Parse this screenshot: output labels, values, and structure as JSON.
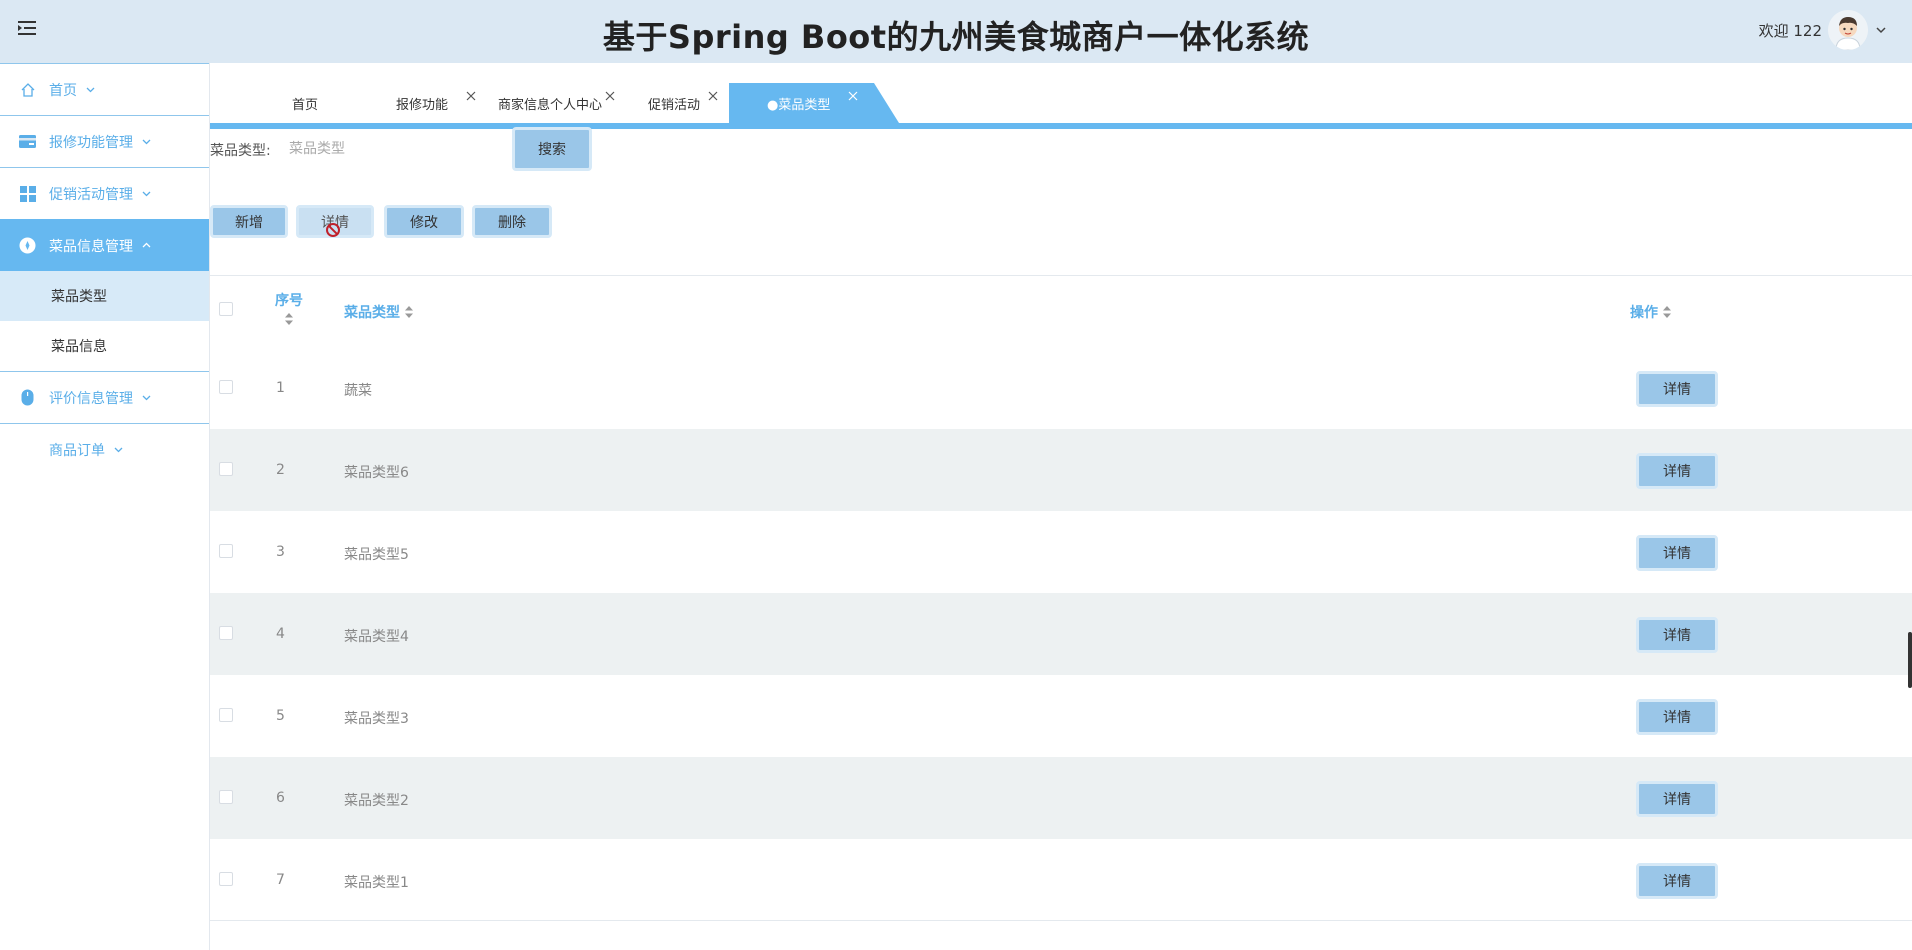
{
  "header": {
    "title": "基于Spring Boot的九州美食城商户一体化系统",
    "welcome": "欢迎 122"
  },
  "sidebar": {
    "items": [
      {
        "label": "首页",
        "icon": "home-icon"
      },
      {
        "label": "报修功能管理",
        "icon": "card-icon"
      },
      {
        "label": "促销活动管理",
        "icon": "grid-icon"
      },
      {
        "label": "菜品信息管理",
        "icon": "compass-icon",
        "active": true
      },
      {
        "label": "评价信息管理",
        "icon": "mouse-icon"
      },
      {
        "label": "商品订单"
      }
    ],
    "subitems": [
      {
        "label": "菜品类型",
        "active": true
      },
      {
        "label": "菜品信息"
      }
    ]
  },
  "tabs": [
    {
      "label": "首页"
    },
    {
      "label": "报修功能"
    },
    {
      "label": "商家信息个人中心"
    },
    {
      "label": "促销活动"
    },
    {
      "label": "●菜品类型",
      "active": true
    }
  ],
  "search": {
    "label": "菜品类型:",
    "placeholder": "菜品类型",
    "button": "搜索"
  },
  "actions": {
    "add": "新增",
    "detail": "详情",
    "edit": "修改",
    "delete": "删除"
  },
  "table": {
    "columns": {
      "index": "序号",
      "type": "菜品类型",
      "op": "操作"
    },
    "detail_label": "详情",
    "rows": [
      {
        "index": "1",
        "name": "蔬菜"
      },
      {
        "index": "2",
        "name": "菜品类型6"
      },
      {
        "index": "3",
        "name": "菜品类型5"
      },
      {
        "index": "4",
        "name": "菜品类型4"
      },
      {
        "index": "5",
        "name": "菜品类型3"
      },
      {
        "index": "6",
        "name": "菜品类型2"
      },
      {
        "index": "7",
        "name": "菜品类型1"
      }
    ]
  },
  "colors": {
    "accent": "#66b8f0",
    "header_bg": "#dbe8f3",
    "button_bg": "#9ac6e8",
    "stripe": "#edf1f2"
  }
}
